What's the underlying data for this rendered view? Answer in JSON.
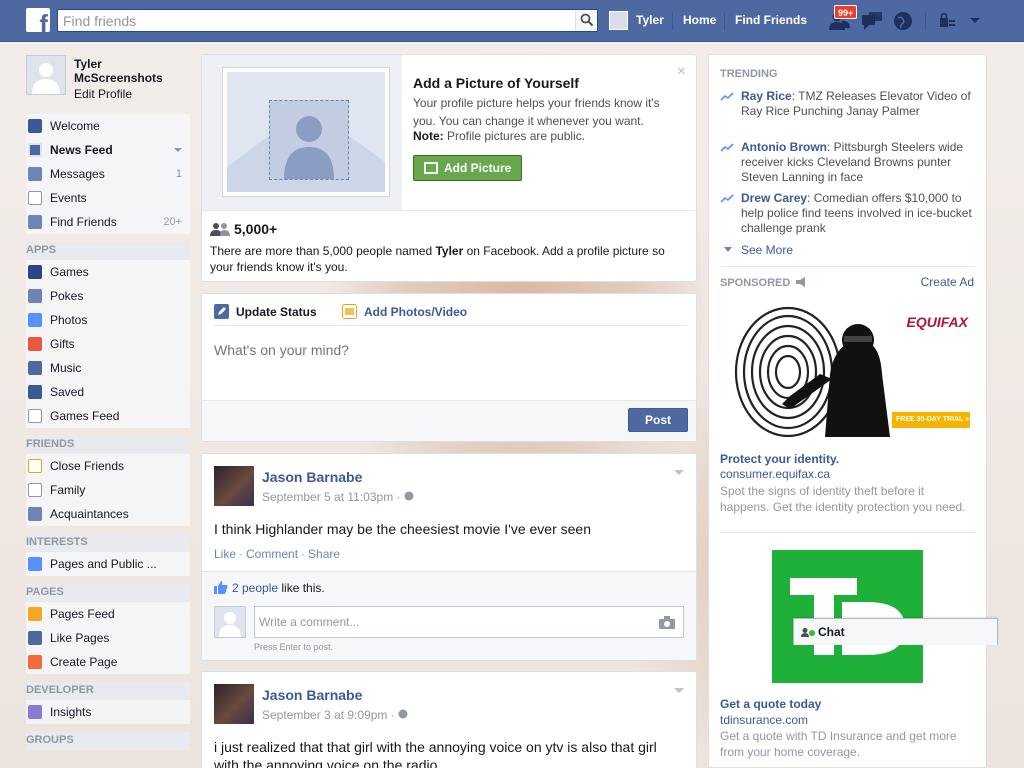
{
  "topbar": {
    "search_placeholder": "Find friends",
    "user_name": "Tyler",
    "home": "Home",
    "find_friends": "Find Friends",
    "notification_count": "99+"
  },
  "leftnav": {
    "name": "Tyler McScreenshots",
    "edit_profile": "Edit Profile",
    "main_items": [
      {
        "label": "Welcome",
        "count": ""
      },
      {
        "label": "News Feed",
        "count": ""
      },
      {
        "label": "Messages",
        "count": "1"
      },
      {
        "label": "Events",
        "count": ""
      },
      {
        "label": "Find Friends",
        "count": "20+"
      }
    ],
    "apps_title": "APPS",
    "apps": [
      "Games",
      "Pokes",
      "Photos",
      "Gifts",
      "Music",
      "Saved",
      "Games Feed"
    ],
    "friends_title": "FRIENDS",
    "friends": [
      "Close Friends",
      "Family",
      "Acquaintances"
    ],
    "interests_title": "INTERESTS",
    "interests": [
      "Pages and Public ..."
    ],
    "pages_title": "PAGES",
    "pages": [
      "Pages Feed",
      "Like Pages",
      "Create Page"
    ],
    "developer_title": "DEVELOPER",
    "developer": [
      "Insights"
    ],
    "groups_title": "GROUPS"
  },
  "profile_prompt": {
    "title": "Add a Picture of Yourself",
    "text": "Your profile picture helps your friends know it's you. You can change it whenever you want.",
    "note_label": "Note:",
    "note_text": " Profile pictures are public.",
    "button": "Add Picture",
    "count": "5,000+",
    "desc_before": "There are more than 5,000 people named ",
    "desc_name": "Tyler",
    "desc_after": " on Facebook. Add a profile picture so your friends know it's you."
  },
  "composer": {
    "tab_status": "Update Status",
    "tab_photo": "Add Photos/Video",
    "placeholder": "What's on your mind?",
    "post_button": "Post"
  },
  "posts": [
    {
      "author": "Jason Barnabe",
      "time": "September 5 at 11:03pm",
      "text": "I think Highlander may be the cheesiest movie I've ever seen",
      "like": "Like",
      "comment": "Comment",
      "share": "Share",
      "likes_link": "2 people",
      "likes_suffix": " like this.",
      "comment_placeholder": "Write a comment...",
      "comment_hint": "Press Enter to post."
    },
    {
      "author": "Jason Barnabe",
      "time": "September 3 at 9:09pm",
      "text": "i just realized that that girl with the annoying voice on ytv is also that girl with the annoying voice on the radio"
    }
  ],
  "rightcol": {
    "trending_title": "TRENDING",
    "trending": [
      {
        "name": "Ray Rice",
        "text": ": TMZ Releases Elevator Video of Ray Rice Punching Janay Palmer"
      },
      {
        "name": "Antonio Brown",
        "text": ": Pittsburgh Steelers wide receiver kicks Cleveland Browns punter Steven Lanning in face"
      },
      {
        "name": "Drew Carey",
        "text": ": Comedian offers $10,000 to help police find teens involved in ice-bucket challenge prank"
      }
    ],
    "see_more": "See More",
    "sponsored_title": "SPONSORED",
    "create_ad": "Create Ad",
    "ads": [
      {
        "brand": "EQUIFAX",
        "trial": "FREE 30-DAY TRIAL »",
        "title": "Protect your identity.",
        "url": "consumer.equifax.ca",
        "desc": "Spot the signs of identity theft before it happens. Get the identity protection you need."
      },
      {
        "title": "Get a quote today",
        "url": "tdinsurance.com",
        "desc": "Get a quote with TD Insurance and get more from your home coverage."
      }
    ],
    "chat": "Chat"
  }
}
